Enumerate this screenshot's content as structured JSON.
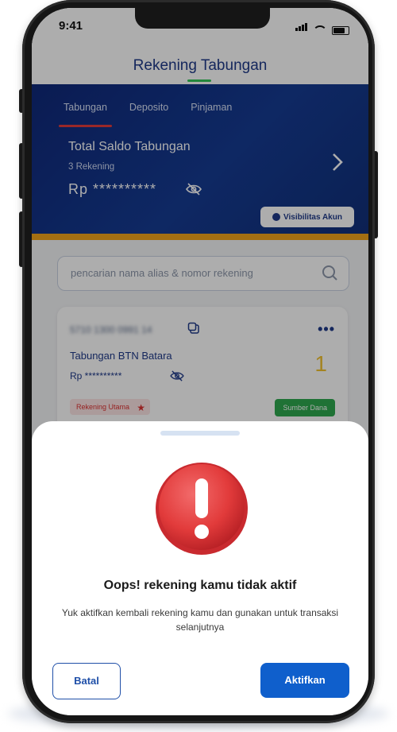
{
  "status_bar": {
    "time": "9:41"
  },
  "header": {
    "title": "Rekening Tabungan"
  },
  "banner": {
    "tabs": [
      {
        "label": "Tabungan",
        "active": true
      },
      {
        "label": "Deposito",
        "active": false
      },
      {
        "label": "Pinjaman",
        "active": false
      }
    ],
    "saldo_title": "Total Saldo Tabungan",
    "account_count": "3 Rekening",
    "amount_masked": "Rp **********",
    "visibility_button": "Visibilitas Akun",
    "accent_color": "#12307a",
    "stripe_color": "#f2a41b"
  },
  "search": {
    "placeholder": "pencarian nama alias & nomor rekening"
  },
  "account_card": {
    "account_number": "5710 1300 0991 14",
    "name": "Tabungan BTN Batara",
    "balance_masked": "Rp **********",
    "number_badge": "1",
    "primary_badge": "Rekening Utama",
    "source_badge": "Sumber Dana"
  },
  "modal": {
    "title": "Oops! rekening kamu tidak aktif",
    "description": "Yuk aktifkan kembali rekening kamu dan gunakan untuk transaksi selanjutnya",
    "cancel_label": "Batal",
    "activate_label": "Aktifkan",
    "icon": "exclamation-alert-icon",
    "primary_color": "#0f5fcc"
  }
}
